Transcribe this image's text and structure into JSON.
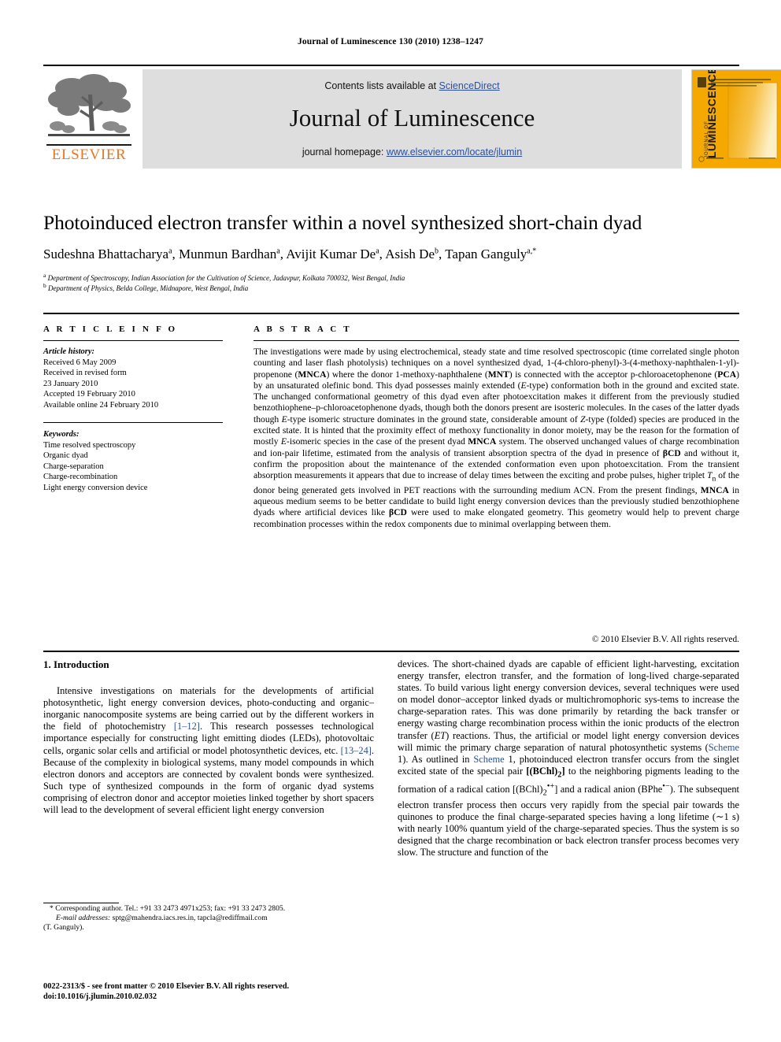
{
  "running_head": "Journal of Luminescence 130 (2010) 1238–1247",
  "masthead": {
    "contents_prefix": "Contents lists available at ",
    "sciencedirect": "ScienceDirect",
    "journal_name": "Journal of Luminescence",
    "homepage_prefix": "journal homepage: ",
    "homepage_url": "www.elsevier.com/locate/jlumin",
    "elsevier_wordmark": "ELSEVIER",
    "cover_title_line1": "JOURNAL OF",
    "cover_title_line2": "LUMINESCENCE",
    "link_color": "#2b4f9e",
    "elsevier_orange": "#E87722",
    "panel_grey": "#dedede",
    "cover_amber": "#F5A800"
  },
  "article": {
    "title": "Photoinduced electron transfer within a novel synthesized short-chain dyad",
    "authors": "Sudeshna Bhattacharya a, Munmun Bardhan a, Avijit Kumar De a, Asish De b, Tapan Ganguly a,*",
    "affiliation_a": "a Department of Spectroscopy, Indian Association for the Cultivation of Science, Jadavpur, Kolkata 700032, West Bengal, India",
    "affiliation_b": "b Department of Physics, Belda College, Midnapore, West Bengal, India"
  },
  "article_info": {
    "heading": "A R T I C L E  I N F O",
    "history_label": "Article history:",
    "history": [
      "Received 6 May 2009",
      "Received in revised form",
      "23 January 2010",
      "Accepted 19 February 2010",
      "Available online 24 February 2010"
    ],
    "keywords_label": "Keywords:",
    "keywords": [
      "Time resolved spectroscopy",
      "Organic dyad",
      "Charge-separation",
      "Charge-recombination",
      "Light energy conversion device"
    ]
  },
  "abstract": {
    "heading": "A B S T R A C T",
    "copyright": "© 2010 Elsevier B.V. All rights reserved."
  },
  "introduction": {
    "heading": "1.  Introduction"
  },
  "footnote": {
    "corresponding": "* Corresponding author. Tel.: +91 33 2473 4971x253; fax: +91 33 2473 2805.",
    "email_label": "E-mail addresses:",
    "emails": "sptg@mahendra.iacs.res.in, tapcla@rediffmail.com",
    "attribution": "(T. Ganguly)."
  },
  "footer": {
    "line1": "0022-2313/$ - see front matter © 2010 Elsevier B.V. All rights reserved.",
    "line2": "doi:10.1016/j.jlumin.2010.02.032"
  }
}
